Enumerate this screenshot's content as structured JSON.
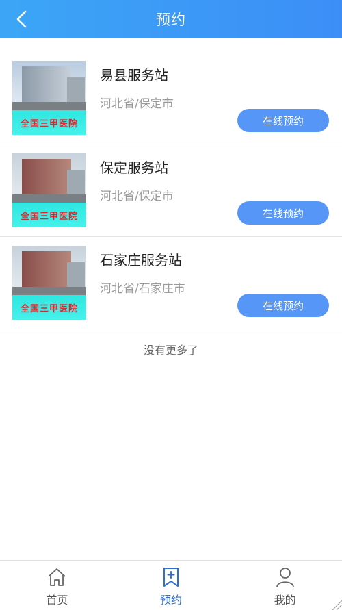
{
  "header": {
    "title": "预约",
    "back_icon": "chevron-left-icon"
  },
  "stations": [
    {
      "name": "易县服务站",
      "region": "河北省/保定市",
      "banner": "全国三甲医院",
      "button": "在线预约"
    },
    {
      "name": "保定服务站",
      "region": "河北省/保定市",
      "banner": "全国三甲医院",
      "button": "在线预约"
    },
    {
      "name": "石家庄服务站",
      "region": "河北省/石家庄市",
      "banner": "全国三甲医院",
      "button": "在线预约"
    }
  ],
  "footer_note": "没有更多了",
  "tabbar": {
    "active": "预约",
    "items": [
      {
        "label": "首页",
        "icon": "home-icon"
      },
      {
        "label": "预约",
        "icon": "bookmark-plus-icon"
      },
      {
        "label": "我的",
        "icon": "user-icon"
      }
    ]
  },
  "colors": {
    "header": "#3ca6f6",
    "button": "#5596f7",
    "active_tab": "#2f6fd4"
  }
}
